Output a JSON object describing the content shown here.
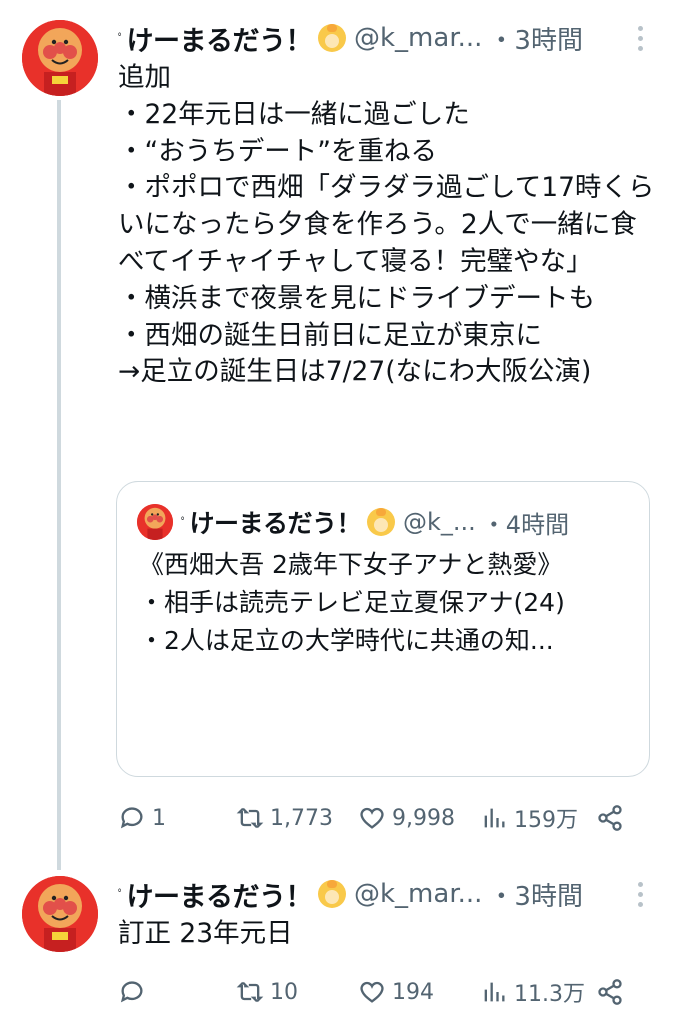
{
  "tweet1": {
    "name": "けーまるだう！",
    "name_mark": "ﾟ",
    "handle": "@k_mar...",
    "time": "・3時間",
    "body": "追加\n・22年元日は一緒に過ごした\n・“おうちデート”を重ねる\n・ポポロで西畑「ダラダラ過ごして17時くらいになったら夕食を作ろう。2人で一緒に食べてイチャイチャして寝る！完璧やな」\n・横浜まで夜景を見にドライブデートも\n・西畑の誕生日前日に足立が東京に\n→足立の誕生日は7/27(なにわ大阪公演)",
    "quote": {
      "name": "けーまるだう！",
      "name_mark": "ﾟ",
      "handle": "@k_...",
      "time": "・4時間",
      "body": "《西畑大吾 2歳年下女子アナと熱愛》\n・相手は読売テレビ足立夏保アナ(24)\n・2人は足立の大学時代に共通の知..."
    },
    "actions": {
      "reply": "1",
      "retweet": "1,773",
      "like": "9,998",
      "views": "159万"
    }
  },
  "tweet2": {
    "name": "けーまるだう！",
    "name_mark": "ﾟ",
    "handle": "@k_mar...",
    "time": "・3時間",
    "body": "訂正 23年元日",
    "actions": {
      "reply": "",
      "retweet": "10",
      "like": "194",
      "views": "11.3万"
    }
  }
}
